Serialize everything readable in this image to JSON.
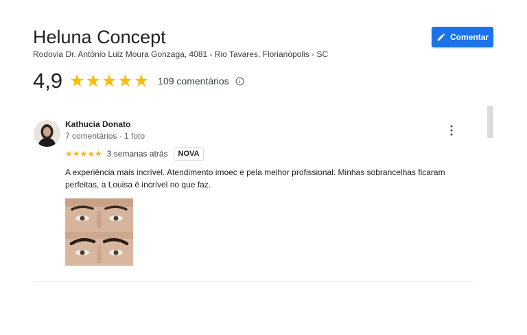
{
  "place": {
    "name": "Heluna Concept",
    "address": "Rodovia Dr. Antônio Luiz Moura Gonzaga, 4081 - Rio Tavares, Florianópolis - SC"
  },
  "actions": {
    "write_review_label": "Comentar"
  },
  "summary": {
    "rating": "4,9",
    "stars": "★★★★★",
    "review_count": "109 comentários",
    "stars_fraction": 1.0
  },
  "review": {
    "author": "Kathucia Donato",
    "meta": "7 comentários · 1 foto",
    "stars": "★★★★★",
    "rating": 5,
    "time": "3 semanas atrás",
    "badge": "NOVA",
    "text": "A experiência mais incrível. Atendimento imoec e pela melhor profissional. Minhas sobrancelhas ficaram perfeitas, a Louisa é incrível no que faz."
  },
  "icons": {
    "pencil": "pencil-icon",
    "info": "info-icon",
    "more": "more-vert-icon",
    "avatar": "avatar"
  },
  "colors": {
    "accent": "#1a73e8",
    "star": "#fbbc04"
  }
}
